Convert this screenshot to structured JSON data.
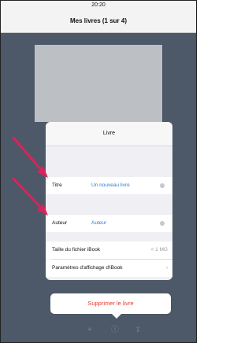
{
  "status_bar": {
    "time": "20:20"
  },
  "nav": {
    "title": "Mes livres (1 sur 4)"
  },
  "popover": {
    "title": "Livre",
    "fields": [
      {
        "label": "Titre",
        "value": "Un nouveau livre"
      },
      {
        "label": "Auteur",
        "value": "Auteur"
      }
    ],
    "file_size": {
      "label": "Taille du fichier iBook",
      "value": "< 1 MG"
    },
    "display_settings": {
      "label": "Paramètres d'affichage d'iBook"
    },
    "delete_label": "Supprimer le livre"
  },
  "toolbar": {
    "icons": [
      "plus-icon",
      "info-icon",
      "share-icon"
    ],
    "plus_glyph": "+",
    "info_glyph": "ⓘ",
    "share_glyph": "⇪"
  },
  "colors": {
    "accent": "#2a7ce0",
    "destructive": "#e23a30",
    "annotation_arrow": "#d8245a",
    "backdrop": "#5a6677"
  }
}
